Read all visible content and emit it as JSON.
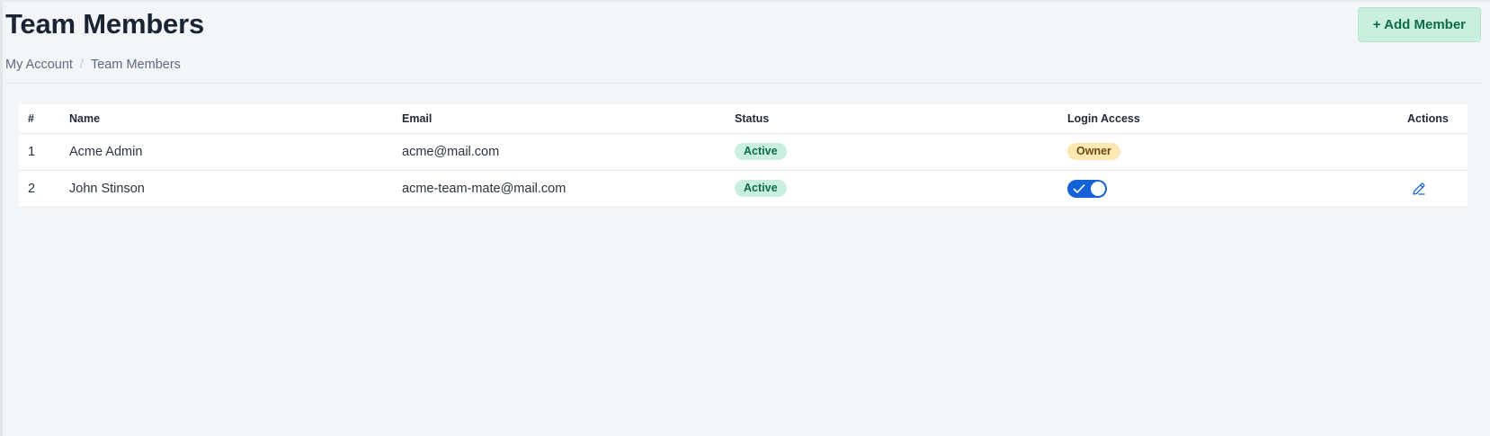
{
  "header": {
    "title": "Team Members",
    "add_button_label": "+ Add Member"
  },
  "breadcrumb": {
    "items": [
      "My Account",
      "Team Members"
    ],
    "separator": "/"
  },
  "table": {
    "columns": [
      "#",
      "Name",
      "Email",
      "Status",
      "Login Access",
      "Actions"
    ],
    "rows": [
      {
        "num": "1",
        "name": "Acme Admin",
        "email": "acme@mail.com",
        "status": "Active",
        "login_access": {
          "type": "badge",
          "label": "Owner"
        },
        "actions": []
      },
      {
        "num": "2",
        "name": "John Stinson",
        "email": "acme-team-mate@mail.com",
        "status": "Active",
        "login_access": {
          "type": "toggle",
          "checked": true
        },
        "actions": [
          "edit-icon"
        ]
      }
    ]
  },
  "colors": {
    "accent": "#1463d6",
    "active_badge_bg": "#c9efdf",
    "owner_badge_bg": "#fde7b3",
    "add_button_bg": "#c9efdf"
  }
}
